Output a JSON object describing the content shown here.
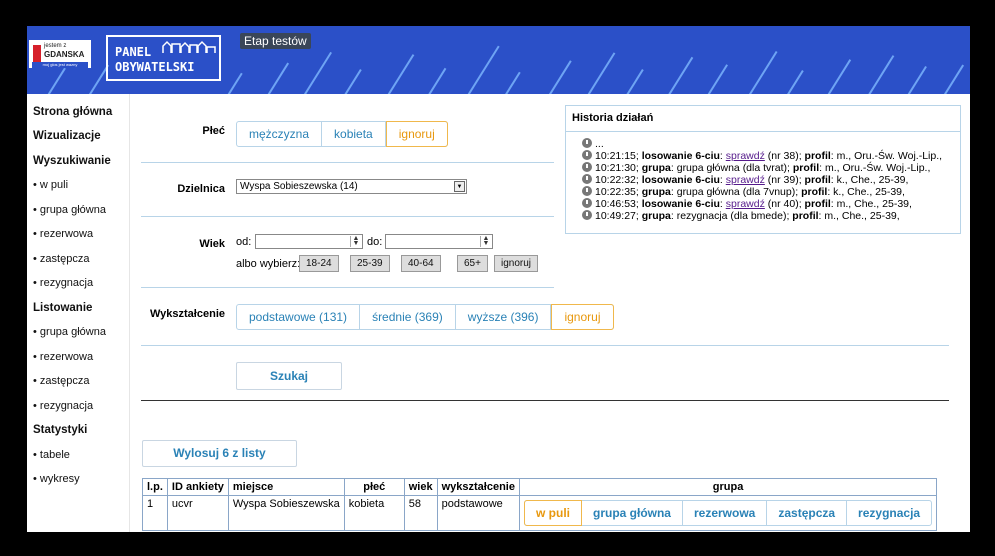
{
  "header": {
    "city_logo_line1": "jestem z",
    "city_logo_line2": "GDANSKA",
    "city_logo_line3": "moj glos jest wazny",
    "panel_logo_line1": "PANEL",
    "panel_logo_line2": "OBYWATELSKI",
    "badge": "Etap testów",
    "brand_color": "#2b50c8"
  },
  "sidebar": {
    "items": [
      {
        "label": "Strona główna",
        "head": true
      },
      {
        "label": "Wizualizacje",
        "head": true
      },
      {
        "label": "Wyszukiwanie",
        "head": true
      },
      {
        "label": "• w puli",
        "head": false
      },
      {
        "label": "• grupa główna",
        "head": false
      },
      {
        "label": "• rezerwowa",
        "head": false
      },
      {
        "label": "• zastępcza",
        "head": false
      },
      {
        "label": "• rezygnacja",
        "head": false
      },
      {
        "label": "Listowanie",
        "head": true
      },
      {
        "label": "• grupa główna",
        "head": false
      },
      {
        "label": "• rezerwowa",
        "head": false
      },
      {
        "label": "• zastępcza",
        "head": false
      },
      {
        "label": "• rezygnacja",
        "head": false
      },
      {
        "label": "Statystyki",
        "head": true
      },
      {
        "label": "• tabele",
        "head": false
      },
      {
        "label": "• wykresy",
        "head": false
      }
    ]
  },
  "form": {
    "gender": {
      "label": "Płeć",
      "options": [
        "mężczyzna",
        "kobieta",
        "ignoruj"
      ],
      "selected": "ignoruj"
    },
    "district": {
      "label": "Dzielnica",
      "value": "Wyspa Sobieszewska (14)"
    },
    "age": {
      "label": "Wiek",
      "from_label": "od:",
      "to_label": "do:",
      "from_value": "",
      "to_value": "",
      "or_choose": "albo wybierz:",
      "presets": [
        "18-24",
        "25-39",
        "40-64",
        "65+",
        "ignoruj"
      ]
    },
    "education": {
      "label": "Wykształcenie",
      "options": [
        "podstawowe (131)",
        "średnie (369)",
        "wyższe (396)",
        "ignoruj"
      ],
      "selected": "ignoruj"
    },
    "search_button": "Szukaj"
  },
  "history": {
    "title": "Historia działań",
    "first": "...",
    "entries": [
      {
        "time": "10:21:15;",
        "action": "losowanie 6-ciu",
        "mid": ": ",
        "link": "sprawdź",
        "after": " (nr 38); ",
        "profil": "profil",
        "profil_val": ": m., Oru.-Św. Woj.-Lip.,"
      },
      {
        "time": "10:21:30;",
        "action": "grupa",
        "mid": ": grupa główna (dla tvrat); ",
        "link": "",
        "after": "",
        "profil": "profil",
        "profil_val": ": m., Oru.-Św. Woj.-Lip.,"
      },
      {
        "time": "10:22:32;",
        "action": "losowanie 6-ciu",
        "mid": ": ",
        "link": "sprawdź",
        "after": " (nr 39); ",
        "profil": "profil",
        "profil_val": ": k., Che., 25-39,"
      },
      {
        "time": "10:22:35;",
        "action": "grupa",
        "mid": ": grupa główna (dla 7vnup); ",
        "link": "",
        "after": "",
        "profil": "profil",
        "profil_val": ": k., Che., 25-39,"
      },
      {
        "time": "10:46:53;",
        "action": "losowanie 6-ciu",
        "mid": ": ",
        "link": "sprawdź",
        "after": " (nr 40); ",
        "profil": "profil",
        "profil_val": ": m., Che., 25-39,"
      },
      {
        "time": "10:49:27;",
        "action": "grupa",
        "mid": ": rezygnacja (dla bmede); ",
        "link": "",
        "after": "",
        "profil": "profil",
        "profil_val": ": m., Che., 25-39,"
      }
    ]
  },
  "draw_button": "Wylosuj 6 z listy",
  "table": {
    "headers": [
      "l.p.",
      "ID ankiety",
      "miejsce",
      "płeć",
      "wiek",
      "wykształcenie",
      "grupa"
    ],
    "rows": [
      {
        "lp": "1",
        "id": "ucvr",
        "place": "Wyspa Sobieszewska",
        "gender": "kobieta",
        "age": "58",
        "edu": "podstawowe"
      }
    ],
    "group_options": [
      "w puli",
      "grupa główna",
      "rezerwowa",
      "zastępcza",
      "rezygnacja"
    ],
    "group_selected": "w puli"
  }
}
